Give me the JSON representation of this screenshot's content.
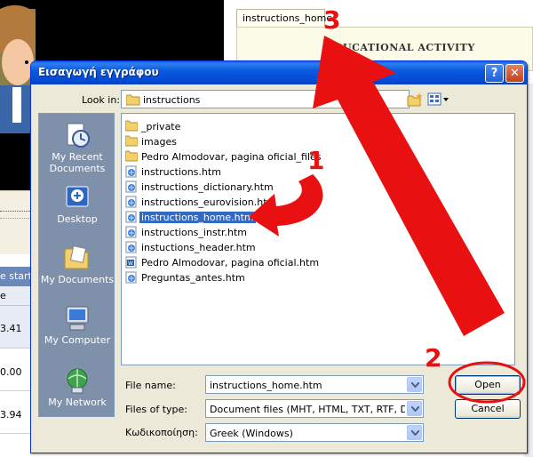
{
  "background": {
    "tab_label": "instructions_home",
    "panel_title": "UCATIONAL ACTIVITY",
    "table_header_1": "e start",
    "table_header_2": "e",
    "table_values": [
      "3.41",
      "0.00",
      "3.94"
    ]
  },
  "dialog": {
    "title": "Εισαγωγή εγγράφου",
    "help_label": "?",
    "close_label": "✕",
    "look_in_label": "Look in:",
    "look_in_value": "instructions",
    "places": [
      {
        "label": "My Recent Documents",
        "icon": "recent-documents-icon"
      },
      {
        "label": "Desktop",
        "icon": "desktop-icon"
      },
      {
        "label": "My Documents",
        "icon": "my-documents-icon"
      },
      {
        "label": "My Computer",
        "icon": "my-computer-icon"
      },
      {
        "label": "My Network",
        "icon": "my-network-icon"
      }
    ],
    "files": [
      {
        "name": "_private",
        "type": "folder"
      },
      {
        "name": "images",
        "type": "folder"
      },
      {
        "name": "Pedro Almodovar, pagina oficial_files",
        "type": "folder"
      },
      {
        "name": "instructions.htm",
        "type": "htm"
      },
      {
        "name": "instructions_dictionary.htm",
        "type": "htm"
      },
      {
        "name": "instructions_eurovision.htm",
        "type": "htm"
      },
      {
        "name": "instructions_home.htm",
        "type": "htm",
        "selected": true
      },
      {
        "name": "instructions_instr.htm",
        "type": "htm"
      },
      {
        "name": "instuctions_header.htm",
        "type": "htm"
      },
      {
        "name": "Pedro Almodovar, pagina oficial.htm",
        "type": "word"
      },
      {
        "name": "Preguntas_antes.htm",
        "type": "htm"
      }
    ],
    "file_name_label": "File name:",
    "file_name_value": "instructions_home.htm",
    "files_of_type_label": "Files of type:",
    "files_of_type_value": "Document files (MHT, HTML, TXT, RTF, DOC,",
    "encoding_label": "Κωδικοποίηση:",
    "encoding_value": "Greek (Windows)",
    "open_label": "Open",
    "cancel_label": "Cancel"
  },
  "annotations": {
    "step1": "1",
    "step2": "2",
    "step3": "3",
    "color": "#e81010"
  }
}
